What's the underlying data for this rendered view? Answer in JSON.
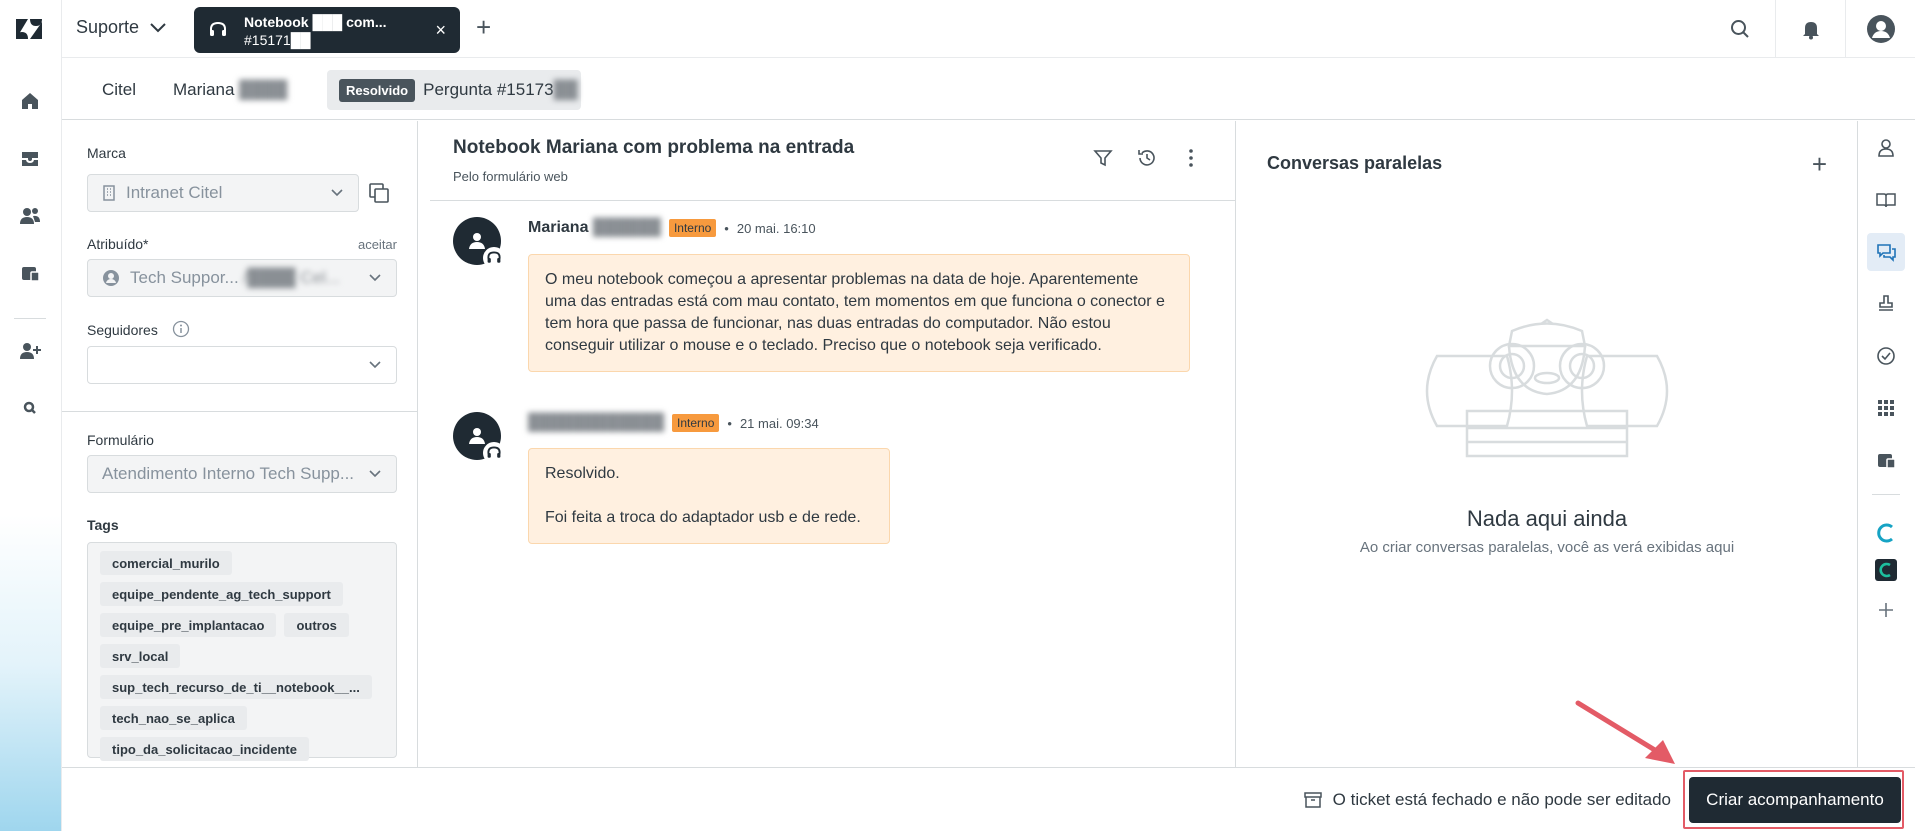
{
  "topbar": {
    "product_label": "Suporte",
    "ticket_tab_title": "Notebook ███ com...",
    "ticket_tab_id": "#15171██",
    "close_tab": "×",
    "add_tab": "+"
  },
  "breadcrumb": {
    "org": "Citel",
    "requester_first": "Mariana",
    "requester_last": "████",
    "status": "Resolvido",
    "ticket_label": "Pergunta #15173",
    "ticket_suffix": "██"
  },
  "properties": {
    "brand_label": "Marca",
    "brand_value": "Intranet Citel",
    "assignee_label": "Atribuído*",
    "accept_label": "aceitar",
    "assignee_value": "Tech Suppor...",
    "assignee_blur": "/████ Cel...",
    "followers_label": "Seguidores",
    "form_label": "Formulário",
    "form_value": "Atendimento Interno Tech Supp...",
    "tags_label": "Tags",
    "tags": [
      "comercial_murilo",
      "equipe_pendente_ag_tech_support",
      "equipe_pre_implantacao",
      "outros",
      "srv_local",
      "sup_tech_recurso_de_ti__notebook__...",
      "tech_nao_se_aplica",
      "tipo_da_solicitacao_incidente"
    ]
  },
  "conversation": {
    "title": "Notebook Mariana com problema na entrada",
    "subtitle": "Pelo formulário web",
    "messages": [
      {
        "author": "Mariana",
        "author_blur": "██████",
        "badge": "Interno",
        "time": "20 mai. 16:10",
        "body": "O meu notebook começou a apresentar problemas na data de hoje. Aparentemente uma das entradas está com mau contato, tem momentos em que funciona o conector e tem hora que passa de funcionar, nas duas entradas do computador. Não estou conseguir utilizar o mouse e o teclado. Preciso que o notebook seja verificado."
      },
      {
        "author": "",
        "author_blur": "████████████",
        "badge": "Interno",
        "time": "21 mai. 09:34",
        "body_line1": "Resolvido.",
        "body_line2": "Foi feita a troca do adaptador usb e de rede."
      }
    ]
  },
  "side_conversations": {
    "title": "Conversas paralelas",
    "add": "+",
    "empty_title": "Nada aqui ainda",
    "empty_subtitle": "Ao criar conversas paralelas, você as verá exibidas aqui"
  },
  "footer": {
    "closed_message": "O ticket está fechado e não pode ser editado",
    "follow_up_button": "Criar acompanhamento"
  },
  "colors": {
    "dark": "#1f2a33",
    "internal_badge": "#f79a3e",
    "internal_bubble": "#fff0e0",
    "highlight": "#e35b66"
  }
}
